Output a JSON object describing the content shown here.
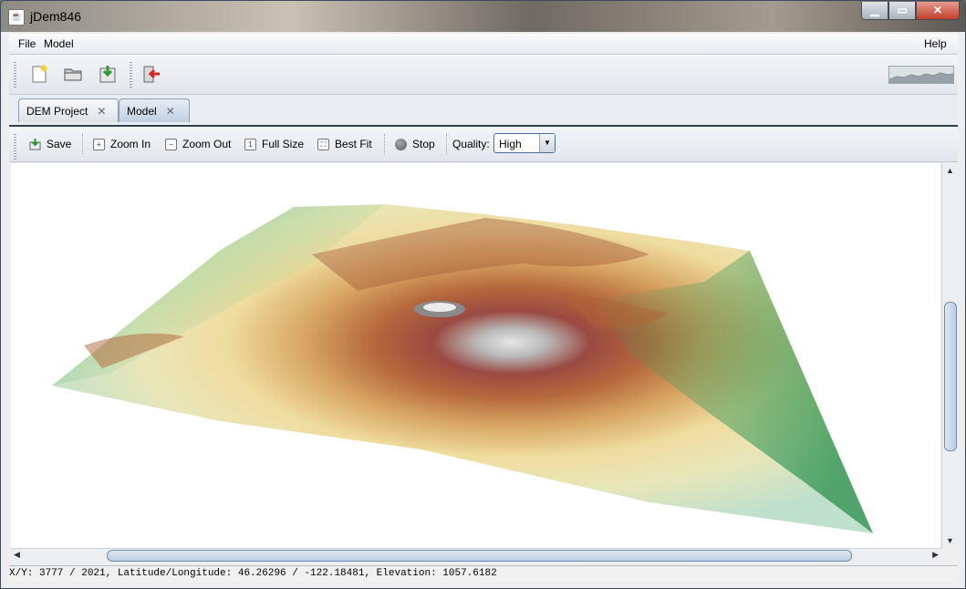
{
  "window": {
    "title": "jDem846",
    "app_icon": "java-cup-icon"
  },
  "menubar": {
    "file": "File",
    "model": "Model",
    "help": "Help"
  },
  "main_toolbar": {
    "icons": [
      "new-project-icon",
      "open-folder-icon",
      "save-download-icon",
      "exit-icon"
    ],
    "memory_indicator": "memory-graph-icon"
  },
  "tabs": [
    {
      "label": "DEM Project",
      "active": false
    },
    {
      "label": "Model",
      "active": true
    }
  ],
  "model_toolbar": {
    "save": "Save",
    "zoom_in": "Zoom In",
    "zoom_out": "Zoom Out",
    "full_size": "Full Size",
    "best_fit": "Best Fit",
    "stop": "Stop",
    "quality_label": "Quality:",
    "quality_value": "High"
  },
  "status": {
    "text": "X/Y: 3777 / 2021, Latitude/Longitude: 46.26296 / -122.18481, Elevation: 1057.6182"
  },
  "colors": {
    "terrain_low": "#9fd8c8",
    "terrain_mid_green": "#3c9a5a",
    "terrain_yellow": "#f1e3a3",
    "terrain_brown": "#a8572f",
    "terrain_red": "#8c3a33",
    "terrain_peak": "#d9d9d9",
    "tab_border": "#2d3e52"
  }
}
